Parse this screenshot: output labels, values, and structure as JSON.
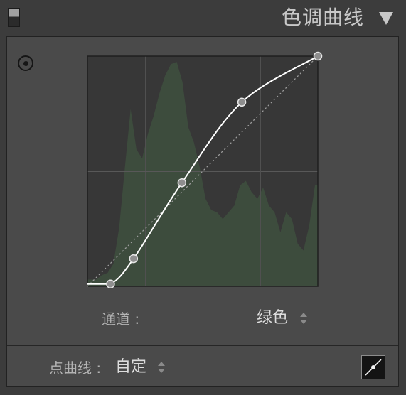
{
  "header": {
    "title": "色调曲线",
    "switch_icon": "panel-switch-icon",
    "collapse_icon": "triangle-down-icon"
  },
  "target_tool": {
    "icon": "target-adjustment-icon"
  },
  "tone_curve": {
    "points": [
      {
        "input_percent": 10,
        "output_percent": 1
      },
      {
        "input_percent": 20,
        "output_percent": 12
      },
      {
        "input_percent": 41,
        "output_percent": 45
      },
      {
        "input_percent": 67,
        "output_percent": 80
      },
      {
        "input_percent": 100,
        "output_percent": 100
      }
    ],
    "histogram_relative": [
      3,
      3,
      5,
      6,
      10,
      26,
      53,
      79,
      61,
      57,
      68,
      76,
      86,
      94,
      99,
      100,
      91,
      71,
      64,
      53,
      39,
      34,
      33,
      30,
      33,
      36,
      45,
      47,
      42,
      39,
      44,
      36,
      33,
      24,
      33,
      30,
      19,
      16,
      27,
      45
    ],
    "grid_divisions": 4,
    "colors": {
      "curve_line": "#ffffff",
      "curve_point_fill": "#8e8e8e",
      "curve_point_outline": "#e6e6e6",
      "histogram_fill": "#3d4c3d",
      "diagonal_line": "#9c9c9c"
    }
  },
  "channel": {
    "label": "通道 :",
    "value": "绿色",
    "select_icon": "up-down-arrows-icon"
  },
  "point_curve": {
    "label": "点曲线 :",
    "value": "自定",
    "select_icon": "up-down-arrows-icon",
    "edit_icon": "point-curve-edit-icon"
  }
}
